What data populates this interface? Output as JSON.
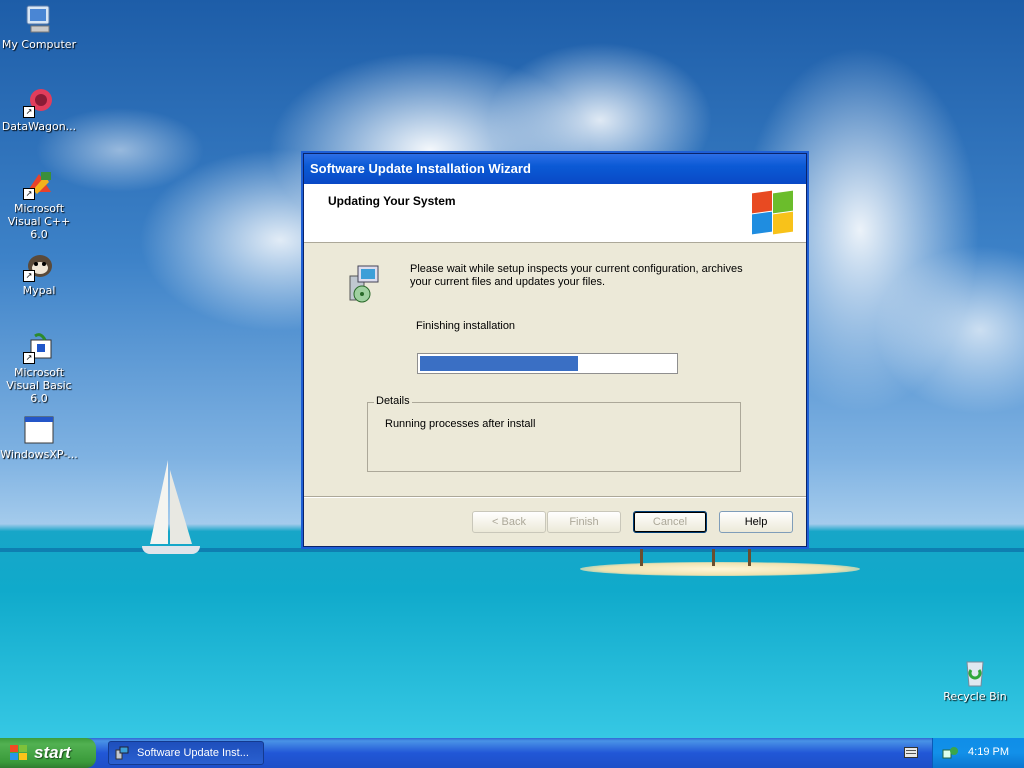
{
  "desktop": {
    "icons": [
      {
        "label": "My Computer",
        "icon": "my-computer-icon"
      },
      {
        "label": "DataWagon...",
        "icon": "datawagon-icon"
      },
      {
        "label": "Microsoft Visual C++ 6.0",
        "icon": "visual-cpp-icon"
      },
      {
        "label": "Mypal",
        "icon": "mypal-icon"
      },
      {
        "label": "Microsoft Visual Basic 6.0",
        "icon": "visual-basic-icon"
      },
      {
        "label": "WindowsXP-...",
        "icon": "window-file-icon"
      }
    ],
    "recycle_bin": {
      "label": "Recycle Bin",
      "icon": "recycle-bin-icon"
    }
  },
  "wizard": {
    "title": "Software Update Installation Wizard",
    "header_title": "Updating Your System",
    "description": "Please wait while setup inspects your current configuration, archives your current files and updates your files.",
    "status": "Finishing installation",
    "progress": 0.62,
    "details_legend": "Details",
    "details_text": "Running processes after install",
    "buttons": {
      "back": "< Back",
      "finish": "Finish",
      "cancel": "Cancel",
      "help": "Help"
    }
  },
  "taskbar": {
    "start_label": "start",
    "task_label": "Software Update Inst...",
    "clock": "4:19 PM"
  },
  "colors": {
    "titlebar": "#0b5ad5",
    "progress_fill": "#3a6fc4",
    "start_green": "#3a9a3a",
    "taskbar_blue": "#2157d7"
  }
}
